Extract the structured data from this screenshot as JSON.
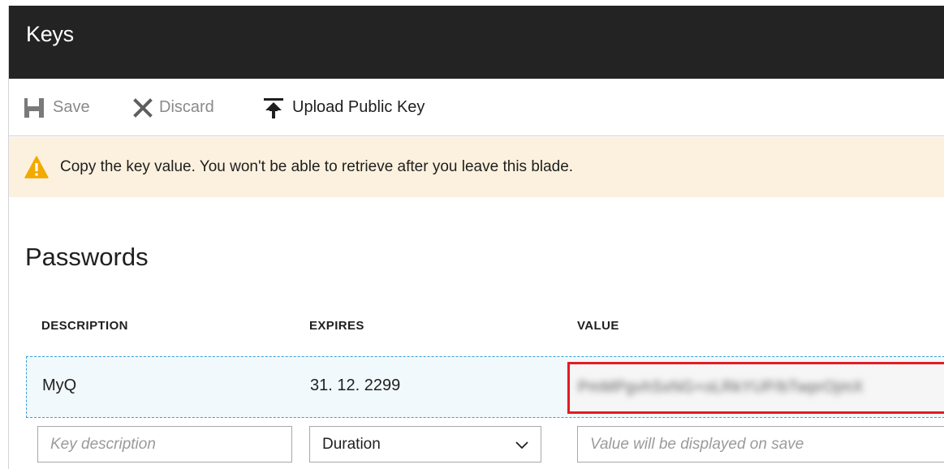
{
  "header": {
    "title": "Keys"
  },
  "toolbar": {
    "save_label": "Save",
    "discard_label": "Discard",
    "upload_label": "Upload Public Key",
    "save_icon": "save-icon",
    "discard_icon": "close-icon",
    "upload_icon": "upload-icon"
  },
  "warning": {
    "icon": "warning-icon",
    "text": "Copy the key value. You won't be able to retrieve after you leave this blade."
  },
  "passwords": {
    "title": "Passwords",
    "columns": [
      "DESCRIPTION",
      "EXPIRES",
      "VALUE"
    ],
    "rows": [
      {
        "description": "MyQ",
        "expires": "31. 12. 2299",
        "value": "PmMPgvhSxNG+oLRkYUP/bTwprOjmX"
      }
    ],
    "new_row": {
      "description_placeholder": "Key description",
      "duration_value": "Duration",
      "value_placeholder": "Value will be displayed on save"
    }
  },
  "colors": {
    "header_bg": "#232323",
    "warning_bg": "#fcf1de",
    "warning_icon": "#f2a900",
    "highlight_border": "#e31b23",
    "row_selected_border": "#3aa0d8"
  }
}
